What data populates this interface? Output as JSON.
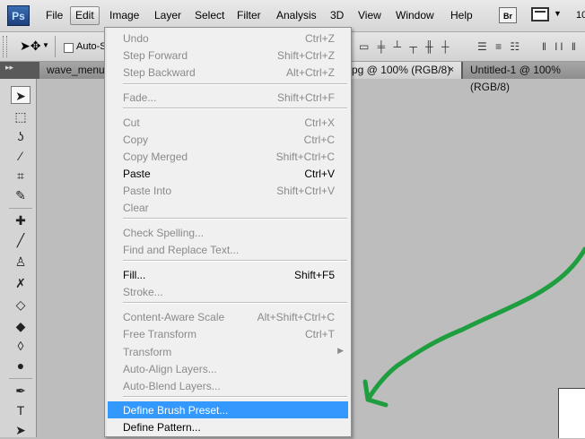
{
  "app": {
    "logo": "Ps"
  },
  "menubar": {
    "items": [
      "File",
      "Edit",
      "Image",
      "Layer",
      "Select",
      "Filter",
      "Analysis",
      "3D",
      "View",
      "Window",
      "Help"
    ],
    "active": "Edit",
    "bridge_label": "Br",
    "zoom_text": "10"
  },
  "options_bar": {
    "auto_select_label": "Auto-S"
  },
  "tabs": [
    {
      "label": "wave_menu."
    },
    {
      "label": "pg @ 100% (RGB/8)",
      "close": "×"
    },
    {
      "label": "Untitled-1 @ 100% (RGB/8)"
    }
  ],
  "edit_menu": {
    "items": [
      {
        "label": "Undo",
        "shortcut": "Ctrl+Z",
        "enabled": false
      },
      {
        "label": "Step Forward",
        "shortcut": "Shift+Ctrl+Z",
        "enabled": false
      },
      {
        "label": "Step Backward",
        "shortcut": "Alt+Ctrl+Z",
        "enabled": false
      },
      {
        "label": "Fade...",
        "shortcut": "Shift+Ctrl+F",
        "enabled": false
      },
      {
        "label": "Cut",
        "shortcut": "Ctrl+X",
        "enabled": false
      },
      {
        "label": "Copy",
        "shortcut": "Ctrl+C",
        "enabled": false
      },
      {
        "label": "Copy Merged",
        "shortcut": "Shift+Ctrl+C",
        "enabled": false
      },
      {
        "label": "Paste",
        "shortcut": "Ctrl+V",
        "enabled": true
      },
      {
        "label": "Paste Into",
        "shortcut": "Shift+Ctrl+V",
        "enabled": false
      },
      {
        "label": "Clear",
        "shortcut": "",
        "enabled": false
      },
      {
        "label": "Check Spelling...",
        "shortcut": "",
        "enabled": false
      },
      {
        "label": "Find and Replace Text...",
        "shortcut": "",
        "enabled": false
      },
      {
        "label": "Fill...",
        "shortcut": "Shift+F5",
        "enabled": true
      },
      {
        "label": "Stroke...",
        "shortcut": "",
        "enabled": false
      },
      {
        "label": "Content-Aware Scale",
        "shortcut": "Alt+Shift+Ctrl+C",
        "enabled": false
      },
      {
        "label": "Free Transform",
        "shortcut": "Ctrl+T",
        "enabled": false
      },
      {
        "label": "Transform",
        "shortcut": "",
        "enabled": false
      },
      {
        "label": "Auto-Align Layers...",
        "shortcut": "",
        "enabled": false
      },
      {
        "label": "Auto-Blend Layers...",
        "shortcut": "",
        "enabled": false
      },
      {
        "label": "Define Brush Preset...",
        "shortcut": "",
        "enabled": true
      },
      {
        "label": "Define Pattern...",
        "shortcut": "",
        "enabled": true
      }
    ]
  },
  "colors": {
    "highlight": "#3399ff",
    "annotation_arrow": "#1e9e3e"
  }
}
